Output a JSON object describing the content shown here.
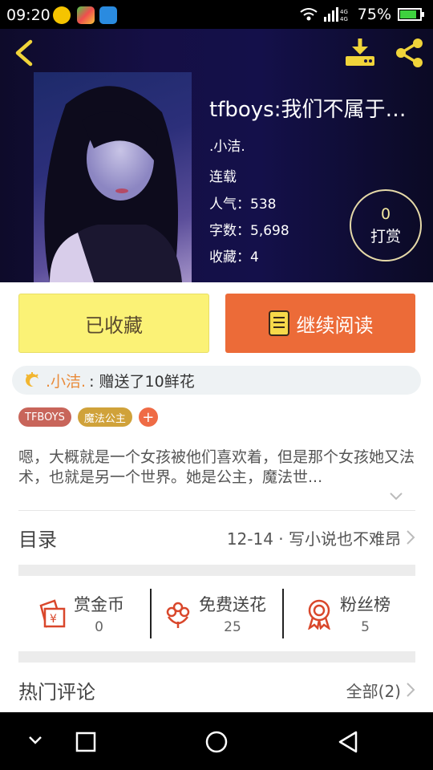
{
  "status_bar": {
    "time": "09:20",
    "battery": "75%",
    "network": "4G"
  },
  "header": {
    "title": "tfboys:我们不属于一...",
    "author": ".小洁.",
    "status": "连载",
    "popularity": "人气：538",
    "word_count": "字数：5,698",
    "collections": "收藏：4",
    "tip_count": "0",
    "tip_label": "打赏"
  },
  "actions": {
    "favorited_label": "已收藏",
    "continue_label": "继续阅读"
  },
  "gift": {
    "user": ".小洁.",
    "text": ": 赠送了10鲜花"
  },
  "tags": [
    {
      "label": "TFBOYS",
      "color": "#c8655a"
    },
    {
      "label": "魔法公主",
      "color": "#d0a23a"
    }
  ],
  "summary": "嗯，大概就是一个女孩被他们喜欢着，但是那个女孩她又法术，也就是另一个世界。她是公主，魔法世...",
  "catalog": {
    "label": "目录",
    "latest": "12-14 · 写小说也不难昂"
  },
  "features": [
    {
      "label": "赏金币",
      "count": "0"
    },
    {
      "label": "免费送花",
      "count": "25"
    },
    {
      "label": "粉丝榜",
      "count": "5"
    }
  ],
  "comments": {
    "label": "热门评论",
    "all_label": "全部(2)"
  },
  "colors": {
    "accent": "#ec6b38",
    "fav_yellow": "#fbf276",
    "icon_red": "#d9472b"
  }
}
